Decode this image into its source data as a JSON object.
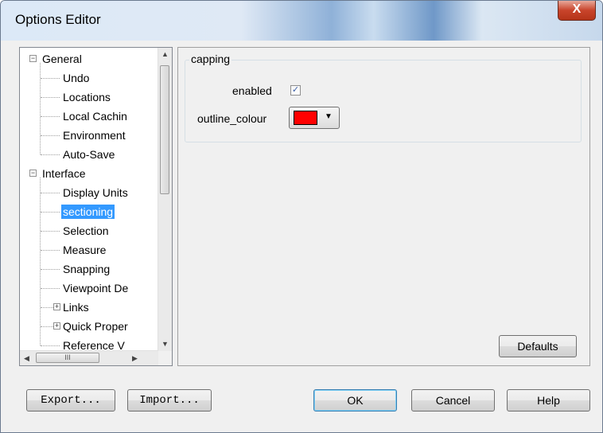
{
  "window": {
    "title": "Options Editor",
    "close_glyph": "X"
  },
  "tree": {
    "items": [
      {
        "label": "General",
        "level": 0,
        "expander": "−"
      },
      {
        "label": "Undo",
        "level": 1
      },
      {
        "label": "Locations",
        "level": 1
      },
      {
        "label": "Local Cachin",
        "level": 1
      },
      {
        "label": "Environment",
        "level": 1
      },
      {
        "label": "Auto-Save",
        "level": 1
      },
      {
        "label": "Interface",
        "level": 0,
        "expander": "−"
      },
      {
        "label": "Display Units",
        "level": 1
      },
      {
        "label": "sectioning",
        "level": 1,
        "selected": true
      },
      {
        "label": "Selection",
        "level": 1
      },
      {
        "label": "Measure",
        "level": 1
      },
      {
        "label": "Snapping",
        "level": 1
      },
      {
        "label": "Viewpoint De",
        "level": 1
      },
      {
        "label": "Links",
        "level": 1,
        "expander": "+"
      },
      {
        "label": "Quick Proper",
        "level": 1,
        "expander": "+"
      },
      {
        "label": "Reference V",
        "level": 1
      }
    ],
    "hscroll_thumb_glyph": "III"
  },
  "capping": {
    "legend": "capping",
    "enabled_label": "enabled",
    "enabled_checked": true,
    "check_glyph": "✓",
    "outline_label": "outline_colour",
    "outline_colour": "#ff0000"
  },
  "buttons": {
    "defaults": "Defaults",
    "export": "Export...",
    "import": "Import...",
    "ok": "OK",
    "cancel": "Cancel",
    "help": "Help"
  }
}
